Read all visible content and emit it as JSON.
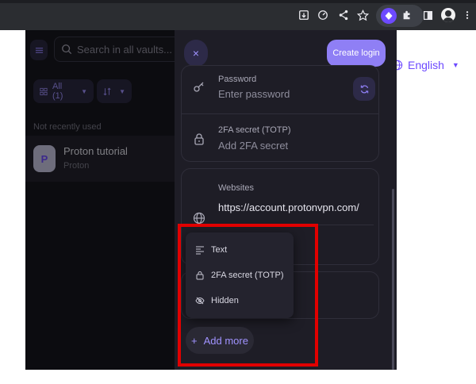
{
  "browser": {
    "icons": [
      "install-icon",
      "speedometer-icon",
      "share-icon",
      "star-icon",
      "proton-pass-extension-icon",
      "puzzle-icon",
      "sidebar-icon",
      "profile-icon",
      "more-vert-icon"
    ]
  },
  "page": {
    "language": "English"
  },
  "sidebar": {
    "search_placeholder": "Search in all vaults...",
    "filter_label": "All (1)",
    "section_label": "Not recently used",
    "vault_item": {
      "initial": "P",
      "title": "Proton tutorial",
      "subtitle": "Proton"
    }
  },
  "editor": {
    "create_button": "Create login",
    "password_label": "Password",
    "password_placeholder": "Enter password",
    "totp_label": "2FA secret (TOTP)",
    "totp_placeholder": "Add 2FA secret",
    "websites_label": "Websites",
    "website_value": "https://account.protonvpn.com/",
    "add_more_label": "Add more"
  },
  "dropdown": {
    "items": [
      "Text",
      "2FA secret (TOTP)",
      "Hidden"
    ]
  },
  "colors": {
    "accent": "#6d4aff",
    "accent_light": "#8f7ff5",
    "highlight": "#e10000",
    "panel_bg": "#1e1d26"
  }
}
